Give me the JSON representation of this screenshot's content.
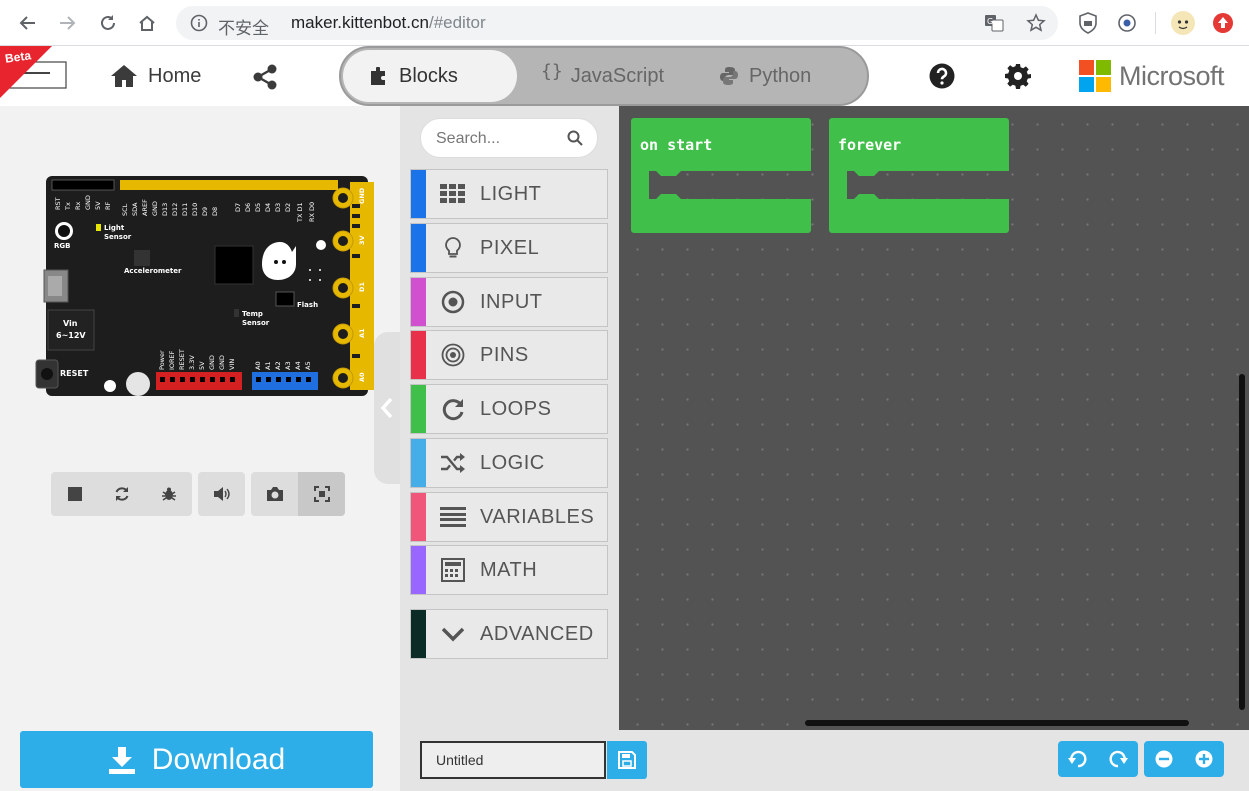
{
  "browser": {
    "insecure_label": "不安全",
    "url_host": "maker.kittenbot.cn",
    "url_path": "/#editor"
  },
  "header": {
    "beta_label": "Beta",
    "home_label": "Home",
    "tabs": [
      {
        "label": "Blocks",
        "active": true
      },
      {
        "label": "JavaScript",
        "active": false
      },
      {
        "label": "Python",
        "active": false
      }
    ],
    "brand_label": "Microsoft"
  },
  "simulator": {
    "board_labels": {
      "rgb": "RGB",
      "light": "Light",
      "sensor": "Sensor",
      "accelerometer": "Accelerometer",
      "temp": "Temp",
      "temp_sensor": "Sensor",
      "flash": "Flash",
      "vin": "Vin",
      "vin_range": "6~12V",
      "reset": "RESET",
      "top_pins_left": [
        "RST",
        "Tx",
        "Rx",
        "GND",
        "5V",
        "RF"
      ],
      "top_pins_mid": [
        "SCL",
        "SDA",
        "AREF",
        "GND",
        "D13",
        "D12",
        "D11",
        "D10",
        "D9",
        "D8"
      ],
      "top_pins_right": [
        "D7",
        "D6",
        "D5",
        "D4",
        "D3",
        "D2",
        "TX D1",
        "RX D0"
      ],
      "edge_pins": [
        "GND",
        "3V",
        "D1",
        "A1",
        "A0"
      ],
      "bottom_pins_left": [
        "Power",
        "IOREF",
        "RESET",
        "3.3V",
        "5V",
        "GND",
        "GND",
        "VIN"
      ],
      "bottom_pins_right": [
        "A0",
        "A1",
        "A2",
        "A3",
        "A4",
        "A5"
      ]
    },
    "download_label": "Download"
  },
  "toolbox": {
    "search_placeholder": "Search...",
    "categories": [
      {
        "label": "LIGHT",
        "color": "#1a73e8",
        "icon": "grid-icon"
      },
      {
        "label": "PIXEL",
        "color": "#1a73e8",
        "icon": "lightbulb-icon"
      },
      {
        "label": "INPUT",
        "color": "#d050d0",
        "icon": "target-icon"
      },
      {
        "label": "PINS",
        "color": "#e8304a",
        "icon": "radar-icon"
      },
      {
        "label": "LOOPS",
        "color": "#40bf4a",
        "icon": "refresh-icon"
      },
      {
        "label": "LOGIC",
        "color": "#45aee8",
        "icon": "shuffle-icon"
      },
      {
        "label": "VARIABLES",
        "color": "#f0567a",
        "icon": "list-icon"
      },
      {
        "label": "MATH",
        "color": "#9966ff",
        "icon": "calculator-icon"
      },
      {
        "label": "ADVANCED",
        "color": "#0b2b26",
        "icon": "chevron-down-icon"
      }
    ]
  },
  "workspace": {
    "blocks": [
      {
        "label": "on start",
        "color": "#40bf4a"
      },
      {
        "label": "forever",
        "color": "#40bf4a"
      }
    ]
  },
  "bottom": {
    "project_name": "Untitled"
  },
  "colors": {
    "accent": "#2eaee8",
    "block_green": "#40bf4a",
    "workspace_bg": "#535353"
  }
}
